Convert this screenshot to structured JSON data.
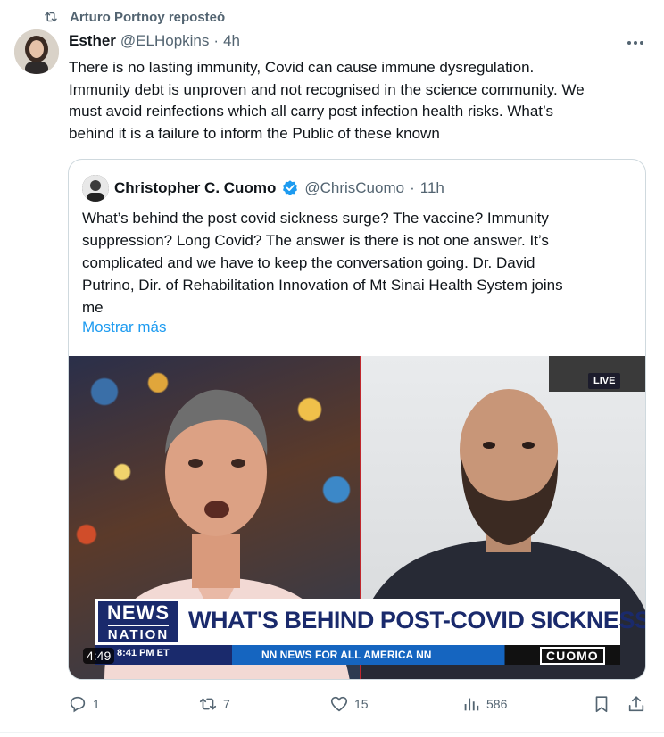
{
  "repost": {
    "text": "Arturo Portnoy reposteó",
    "icon": "repost-icon"
  },
  "tweet": {
    "author_name": "Esther",
    "author_handle": "@ELHopkins",
    "separator": "·",
    "time": "4h",
    "lines": [
      "There is no lasting immunity, Covid can cause immune dysregulation.",
      "Immunity debt is unproven and not recognised in the science community. We",
      "must avoid reinfections which all carry post infection health risks. What’s",
      "behind it is a failure to inform the Public of these known"
    ]
  },
  "quote": {
    "author_name": "Christopher C. Cuomo",
    "author_handle": "@ChrisCuomo",
    "separator": "·",
    "time": "11h",
    "verified_color": "#1d9bf0",
    "lines": [
      "What’s behind the post covid sickness surge? The vaccine? Immunity",
      "suppression? Long Covid? The answer is there is not one answer. It’s",
      "complicated and we have to keep the conversation going. Dr. David",
      "Putrino, Dir. of Rehabilitation Innovation of Mt Sinai Health System joins",
      "me"
    ],
    "show_more": "Mostrar más",
    "video": {
      "live_badge": "LIVE",
      "logo_line1": "NEWS",
      "logo_line2": "NATION",
      "headline": "WHAT'S BEHIND POST-COVID SICKNESS SURGE?",
      "ticker_time": "8:41 PM ET",
      "ticker_text": "NN NEWS FOR ALL AMERICA NN",
      "ticker_brand": "CUOMO",
      "duration": "4:49"
    }
  },
  "actions": {
    "reply_count": "1",
    "repost_count": "7",
    "like_count": "15",
    "views_count": "586"
  },
  "colors": {
    "accent": "#1d9bf0",
    "muted": "#536471",
    "newsnation_blue": "#1a2a6c"
  }
}
